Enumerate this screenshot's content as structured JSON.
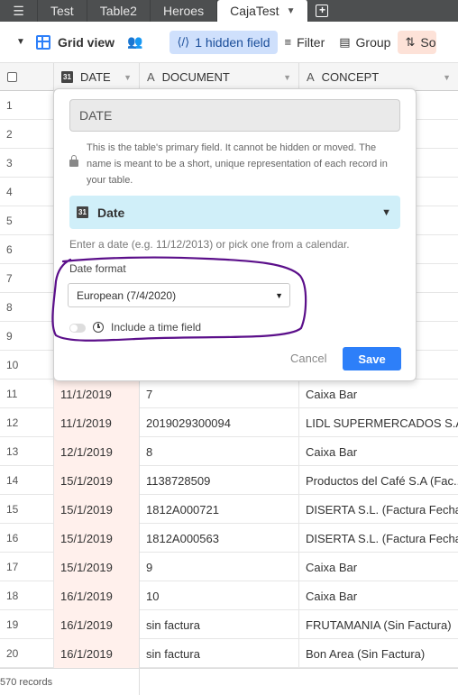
{
  "tabs": [
    {
      "label": "Test"
    },
    {
      "label": "Table2"
    },
    {
      "label": "Heroes"
    },
    {
      "label": "CajaTest",
      "active": true
    }
  ],
  "toolbar": {
    "view_name": "Grid view",
    "hidden_fields": "1 hidden field",
    "filter": "Filter",
    "group": "Group",
    "sort": "So"
  },
  "columns": {
    "date": "DATE",
    "document": "DOCUMENT",
    "concept": "CONCEPT"
  },
  "rows": [
    {
      "n": "1",
      "date": "",
      "document": "",
      "concept": ""
    },
    {
      "n": "2",
      "date": "",
      "document": "",
      "concept": ""
    },
    {
      "n": "3",
      "date": "",
      "document": "",
      "concept": ""
    },
    {
      "n": "4",
      "date": "",
      "document": "",
      "concept": "no Ga..."
    },
    {
      "n": "5",
      "date": "",
      "document": "",
      "concept": "NA"
    },
    {
      "n": "6",
      "date": "",
      "document": "",
      "concept": "OS S.A..."
    },
    {
      "n": "7",
      "date": "",
      "document": "",
      "concept": ""
    },
    {
      "n": "8",
      "date": "",
      "document": "",
      "concept": "RINTE..."
    },
    {
      "n": "9",
      "date": "",
      "document": "",
      "concept": ""
    },
    {
      "n": "10",
      "date": "",
      "document": "",
      "concept": ""
    },
    {
      "n": "11",
      "date": "11/1/2019",
      "document": "7",
      "concept": "Caixa Bar"
    },
    {
      "n": "12",
      "date": "11/1/2019",
      "document": "2019029300094",
      "concept": "LIDL SUPERMERCADOS S.A..."
    },
    {
      "n": "13",
      "date": "12/1/2019",
      "document": "8",
      "concept": "Caixa Bar"
    },
    {
      "n": "14",
      "date": "15/1/2019",
      "document": "1138728509",
      "concept": "Productos del Café S.A (Fac..."
    },
    {
      "n": "15",
      "date": "15/1/2019",
      "document": "1812A000721",
      "concept": "DISERTA S.L. (Factura Fecha..."
    },
    {
      "n": "16",
      "date": "15/1/2019",
      "document": "1812A000563",
      "concept": "DISERTA S.L. (Factura Fecha..."
    },
    {
      "n": "17",
      "date": "15/1/2019",
      "document": "9",
      "concept": "Caixa Bar"
    },
    {
      "n": "18",
      "date": "16/1/2019",
      "document": "10",
      "concept": "Caixa Bar"
    },
    {
      "n": "19",
      "date": "16/1/2019",
      "document": "sin factura",
      "concept": "FRUTAMANIA (Sin Factura)"
    },
    {
      "n": "20",
      "date": "16/1/2019",
      "document": "sin factura",
      "concept": "Bon Area (Sin Factura)"
    }
  ],
  "footer": {
    "records": "570 records"
  },
  "dialog": {
    "field_name": "DATE",
    "info": "This is the table's primary field. It cannot be hidden or moved. The name is meant to be a short, unique representation of each record in your table.",
    "field_type": "Date",
    "hint": "Enter a date (e.g. 11/12/2013) or pick one from a calendar.",
    "date_format_label": "Date format",
    "date_format_value": "European (7/4/2020)",
    "include_time_label": "Include a time field",
    "include_time": false,
    "cancel": "Cancel",
    "save": "Save"
  },
  "colors": {
    "accent": "#2d7ff9",
    "annotation": "#5b0f8a",
    "date_column_bg": "#fff0ec"
  }
}
